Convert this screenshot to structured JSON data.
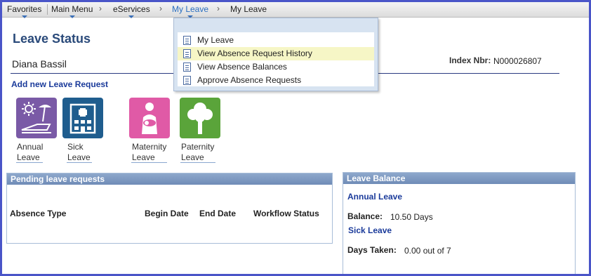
{
  "nav": {
    "items": [
      {
        "label": "Favorites"
      },
      {
        "label": "Main Menu"
      },
      {
        "label": "eServices"
      },
      {
        "label": "My Leave"
      },
      {
        "label": "My Leave"
      }
    ],
    "separator": "›"
  },
  "dropdown": {
    "items": [
      {
        "label": "My Leave"
      },
      {
        "label": "View Absence Request History"
      },
      {
        "label": "View Absence Balances"
      },
      {
        "label": "Approve Absence Requests"
      }
    ]
  },
  "page": {
    "title": "Leave Status",
    "user_name": "Diana Bassil",
    "index_label": "Index Nbr:",
    "index_value": "N000026807",
    "add_link": "Add new Leave Request"
  },
  "tiles": [
    {
      "line1": "Annual",
      "line2": "Leave",
      "color": "#7a5aa6",
      "icon": "beach-chair-icon"
    },
    {
      "line1": "Sick",
      "line2": "Leave",
      "color": "#1f5d8e",
      "icon": "hospital-icon"
    },
    {
      "line1": "Maternity",
      "line2": "Leave",
      "color": "#e05aa6",
      "icon": "mother-baby-icon"
    },
    {
      "line1": "Paternity",
      "line2": "Leave",
      "color": "#5aa43a",
      "icon": "tree-icon"
    }
  ],
  "pending": {
    "title": "Pending leave requests",
    "columns": [
      "Absence Type",
      "Begin Date",
      "End Date",
      "Workflow Status"
    ]
  },
  "balance": {
    "title": "Leave Balance",
    "annual_label": "Annual Leave",
    "balance_label": "Balance:",
    "balance_value": "10.50 Days",
    "sick_label": "Sick Leave",
    "taken_label": "Days Taken:",
    "taken_value": "0.00 out of 7"
  }
}
